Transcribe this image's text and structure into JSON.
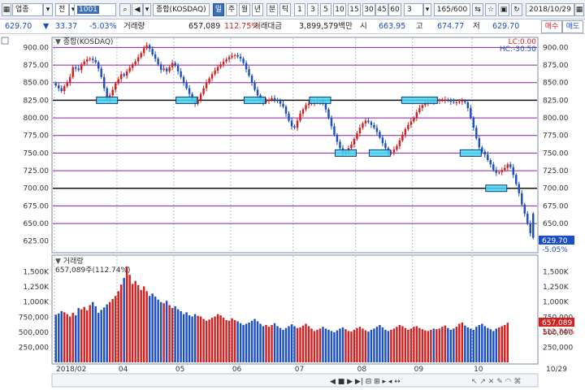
{
  "toolbar": {
    "menu_label": "업종",
    "type_label": "전",
    "code": "1001",
    "name": "종합(KOSDAQ)",
    "periods": [
      "일",
      "주",
      "월",
      "년",
      "분",
      "틱"
    ],
    "minutes": [
      "1",
      "3",
      "5",
      "10",
      "15",
      "30",
      "45",
      "60"
    ],
    "interval": "3",
    "count": "165/600",
    "date": "2018/10/29"
  },
  "infobar": {
    "price": "629.70",
    "change": "33.37",
    "change_pct": "-5.03%",
    "volume_label": "거래량",
    "volume": "657,089",
    "volume_pct": "112.75%",
    "amount_label": "거래대금",
    "amount": "3,899,579백만",
    "open_label": "시",
    "open": "663.95",
    "high_label": "고",
    "high": "674.77",
    "low_label": "저",
    "low": "629.70"
  },
  "side_buttons": {
    "buy": "매수",
    "sell": "매도"
  },
  "chart": {
    "title": "종합(KOSDAQ)",
    "lc": "LC:0.00",
    "hc": "HC:-30.50",
    "price_ticks": [
      "900.00",
      "875.00",
      "850.00",
      "825.00",
      "800.00",
      "775.00",
      "750.00",
      "725.00",
      "700.00",
      "675.00",
      "650.00",
      "625.00"
    ],
    "price_ticks_right": [
      "900.00",
      "875.00",
      "850.00",
      "825.00",
      "800.00",
      "775.00",
      "750.00",
      "725.00",
      "700.00",
      "675.00",
      "650.00",
      "625.00"
    ],
    "last_price_tag": "629.70",
    "last_change_tag": "-5.05%",
    "volume_title": "거래량",
    "volume_info": "657,089주(112.74%)",
    "volume_ticks": [
      "1,500K",
      "1,250K",
      "1,000K",
      "750,000",
      "500,000",
      "250,000"
    ],
    "volume_ticks_right": [
      "1,500K",
      "1,250K",
      "1,000K",
      "750,000",
      "500,000",
      "250,000"
    ],
    "volume_tag": "657,089",
    "volume_pct_tag": "112.74%",
    "x_labels": [
      "2018/02",
      "04",
      "05",
      "06",
      "07",
      "08",
      "09",
      "10"
    ],
    "x_last": "10/29",
    "colors": {
      "up": "#d22020",
      "down": "#1c4fc3",
      "purple": "#8a1fa0",
      "box": "#47d6ee"
    }
  },
  "chart_data": {
    "type": "candlestick",
    "y_range_price": [
      612,
      912
    ],
    "y_range_volume": [
      0,
      1750000
    ],
    "support_lines": [
      825,
      700
    ],
    "guide_lines": [
      900,
      875,
      850,
      800,
      775,
      750,
      725,
      675,
      650
    ],
    "closes": [
      846,
      842,
      838,
      845,
      850,
      858,
      872,
      870,
      868,
      876,
      880,
      883,
      884,
      882,
      879,
      870,
      858,
      842,
      826,
      832,
      840,
      849,
      855,
      862,
      860,
      866,
      871,
      876,
      880,
      886,
      892,
      899,
      903,
      898,
      890,
      884,
      876,
      868,
      870,
      866,
      872,
      878,
      874,
      866,
      858,
      850,
      842,
      834,
      826,
      820,
      826,
      834,
      842,
      850,
      856,
      862,
      867,
      872,
      876,
      880,
      883,
      886,
      888,
      889,
      887,
      884,
      878,
      869,
      860,
      850,
      840,
      832,
      826,
      822,
      824,
      826,
      828,
      826,
      824,
      820,
      816,
      806,
      796,
      788,
      786,
      796,
      806,
      812,
      818,
      820,
      821,
      822,
      823,
      824,
      820,
      812,
      800,
      788,
      776,
      766,
      757,
      750,
      752,
      757,
      762,
      770,
      778,
      786,
      792,
      796,
      794,
      790,
      786,
      780,
      772,
      764,
      757,
      750,
      751,
      755,
      760,
      768,
      776,
      784,
      790,
      795,
      800,
      808,
      814,
      818,
      821,
      823,
      824,
      823,
      824,
      825,
      825,
      826,
      825,
      823,
      822,
      822,
      823,
      824,
      822,
      814,
      800,
      786,
      771,
      758,
      752,
      748,
      740,
      734,
      726,
      722,
      723,
      726,
      729,
      734,
      730,
      719,
      706,
      693,
      677,
      664,
      650,
      636,
      629.7
    ],
    "volumes_k": [
      790,
      810,
      850,
      830,
      800,
      760,
      820,
      780,
      900,
      880,
      920,
      860,
      950,
      1000,
      930,
      820,
      870,
      910,
      960,
      1000,
      1050,
      1100,
      1180,
      1290,
      1400,
      1590,
      1450,
      1300,
      1350,
      1280,
      1200,
      1260,
      1180,
      1100,
      1140,
      1090,
      1040,
      1000,
      980,
      1020,
      950,
      900,
      930,
      880,
      850,
      800,
      830,
      780,
      760,
      800,
      770,
      760,
      720,
      690,
      710,
      740,
      760,
      800,
      780,
      740,
      700,
      690,
      730,
      700,
      680,
      650,
      620,
      640,
      660,
      690,
      720,
      680,
      640,
      600,
      620,
      590,
      620,
      650,
      600,
      570,
      540,
      570,
      600,
      630,
      600,
      570,
      580,
      610,
      640,
      600,
      560,
      520,
      540,
      560,
      590,
      560,
      540,
      520,
      500,
      530,
      560,
      580,
      550,
      520,
      510,
      540,
      570,
      590,
      560,
      530,
      510,
      540,
      560,
      590,
      620,
      580,
      540,
      520,
      540,
      560,
      590,
      620,
      600,
      570,
      540,
      560,
      590,
      600,
      570,
      550,
      530,
      520,
      540,
      560,
      550,
      560,
      590,
      610,
      570,
      540,
      560,
      590,
      640,
      660,
      610,
      580,
      560,
      540,
      590,
      620,
      640,
      600,
      570,
      550,
      520,
      560,
      580,
      600,
      620,
      657.089
    ]
  }
}
